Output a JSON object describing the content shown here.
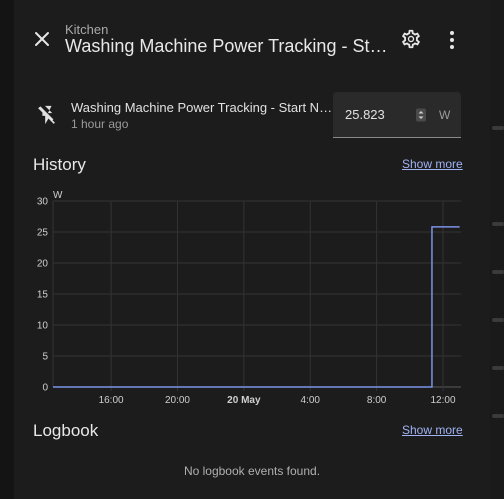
{
  "header": {
    "subtitle": "Kitchen",
    "title": "Washing Machine Power Tracking - Start Number"
  },
  "entity": {
    "name": "Washing Machine Power Tracking - Start Number",
    "last_changed": "1 hour ago",
    "value": "25.823",
    "unit": "W"
  },
  "history": {
    "title": "History",
    "show_more": "Show more"
  },
  "logbook": {
    "title": "Logbook",
    "show_more": "Show more",
    "empty": "No logbook events found."
  },
  "icons": {
    "close": "close-icon",
    "settings": "gear-icon",
    "menu": "dots-vertical-icon",
    "entity": "flash-off-icon",
    "spinner": "spinner-arrows-icon"
  },
  "colors": {
    "accent": "#7b93e8",
    "link": "#9fb3f5"
  },
  "chart_data": {
    "type": "line",
    "ylabel": "W",
    "ylim": [
      0,
      30
    ],
    "y_ticks": [
      "0",
      "5",
      "10",
      "15",
      "20",
      "25",
      "30"
    ],
    "x_ticks": [
      "16:00",
      "20:00",
      "20 May",
      "4:00",
      "8:00",
      "12:00"
    ],
    "series": [
      {
        "x": [
          "19 May 12:30",
          "20 May 11:20",
          "20 May 11:20",
          "20 May 13:00"
        ],
        "values": [
          0,
          0,
          25.823,
          25.823
        ]
      }
    ],
    "grid": true
  }
}
